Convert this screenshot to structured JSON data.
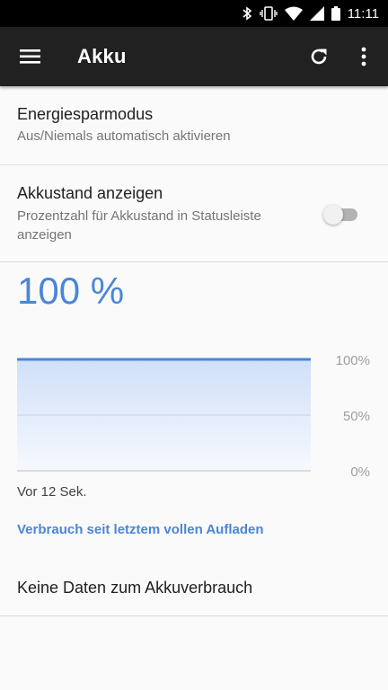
{
  "status_bar": {
    "time": "11:11",
    "icons": [
      "bluetooth-icon",
      "vibrate-icon",
      "wifi-icon",
      "signal-icon",
      "battery-icon"
    ]
  },
  "toolbar": {
    "title": "Akku",
    "icons": [
      "menu-icon",
      "refresh-icon",
      "more-vert-icon"
    ],
    "background_color": "#212121"
  },
  "preferences": [
    {
      "title": "Energiesparmodus",
      "summary": "Aus/Niemals automatisch aktivieren"
    },
    {
      "title": "Akkustand anzeigen",
      "summary": "Prozentzahl für Akkustand in Statusleiste anzeigen",
      "toggle_on": false
    }
  ],
  "battery": {
    "level_text": "100 %",
    "accent_color": "#4a86d8",
    "since_text": "Vor 12 Sek."
  },
  "chart_data": {
    "type": "area",
    "y_tick_labels": [
      "100%",
      "50%",
      "0%"
    ],
    "ylim": [
      0,
      100
    ],
    "values": [
      100,
      100
    ],
    "grid": true
  },
  "usage_link": "Verbrauch seit letztem vollen Aufladen",
  "no_data_text": "Keine Daten zum Akkuverbrauch"
}
